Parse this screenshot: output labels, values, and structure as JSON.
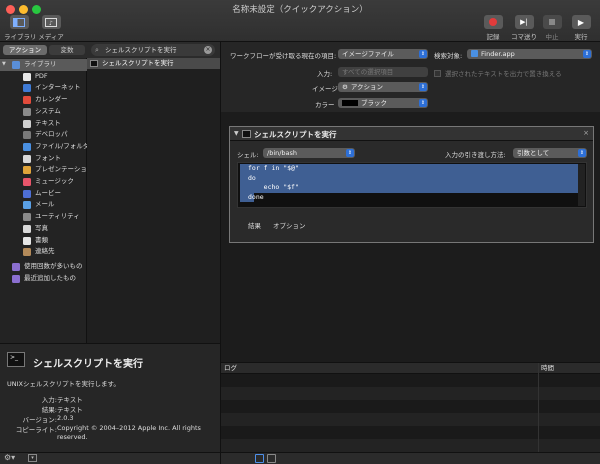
{
  "window": {
    "title": "名称未設定（クイックアクション）"
  },
  "toolbar": {
    "library": "ライブラリ",
    "media": "メディア",
    "record": "記録",
    "step": "コマ送り",
    "stop": "中止",
    "run": "実行"
  },
  "sidebar": {
    "tab_actions": "アクション",
    "tab_variables": "変数",
    "search_value": "シェルスクリプトを実行",
    "categories": [
      {
        "label": "ライブラリ",
        "icon": "library-icon",
        "color": "#5a8fd8"
      },
      {
        "label": "PDF",
        "icon": "pdf-icon",
        "color": "#e8e8e8"
      },
      {
        "label": "インターネット",
        "icon": "internet-icon",
        "color": "#3f7bd6"
      },
      {
        "label": "カレンダー",
        "icon": "calendar-icon",
        "color": "#e24b3b"
      },
      {
        "label": "システム",
        "icon": "system-icon",
        "color": "#8a8a8a"
      },
      {
        "label": "テキスト",
        "icon": "text-icon",
        "color": "#cfcfcf"
      },
      {
        "label": "デベロッパ",
        "icon": "developer-icon",
        "color": "#7a7a7a"
      },
      {
        "label": "ファイル/フォルダ",
        "icon": "folder-icon",
        "color": "#4a90e2"
      },
      {
        "label": "フォント",
        "icon": "font-icon",
        "color": "#d8d8d8"
      },
      {
        "label": "プレゼンテーション",
        "icon": "presentation-icon",
        "color": "#e0a43a"
      },
      {
        "label": "ミュージック",
        "icon": "music-icon",
        "color": "#e8556a"
      },
      {
        "label": "ムービー",
        "icon": "movie-icon",
        "color": "#4e6fd6"
      },
      {
        "label": "メール",
        "icon": "mail-icon",
        "color": "#5aa0e6"
      },
      {
        "label": "ユーティリティ",
        "icon": "utility-icon",
        "color": "#8a8a8a"
      },
      {
        "label": "写真",
        "icon": "photo-icon",
        "color": "#d9d9d9"
      },
      {
        "label": "書類",
        "icon": "document-icon",
        "color": "#e6e6e6"
      },
      {
        "label": "連絡先",
        "icon": "contacts-icon",
        "color": "#b38a5a"
      },
      {
        "label": "使用回数が多いもの",
        "icon": "smart-folder-icon",
        "color": "#8b6fd0"
      },
      {
        "label": "最近追加したもの",
        "icon": "smart-folder-icon",
        "color": "#8b6fd0"
      }
    ],
    "result_item": "シェルスクリプトを実行"
  },
  "description": {
    "title": "シェルスクリプトを実行",
    "summary": "UNIXシェルスクリプトを実行します。",
    "input_label": "入力:",
    "input_value": "テキスト",
    "result_label": "結果:",
    "result_value": "テキスト",
    "version_label": "バージョン:",
    "version_value": "2.0.3",
    "copyright_label": "コピーライト:",
    "copyright_value": "Copyright © 2004–2012 Apple Inc.  All rights reserved."
  },
  "workflow": {
    "receives_label": "ワークフローが受け取る現在の項目:",
    "receives_value": "イメージファイル",
    "search_target_label": "検索対象:",
    "search_target_value": "Finder.app",
    "input_label": "入力:",
    "input_value": "すべての選択項目",
    "replace_text_label": "選択されたテキストを出力で置き換える",
    "image_label": "イメージ",
    "image_value": "アクション",
    "color_label": "カラー",
    "color_value": "ブラック"
  },
  "action": {
    "title": "シェルスクリプトを実行",
    "shell_label": "シェル:",
    "shell_value": "/bin/bash",
    "pass_input_label": "入力の引き渡し方法:",
    "pass_input_value": "引数として",
    "code_lines": [
      "for f in \"$@\"",
      "do",
      "    echo \"$f\"",
      "done"
    ],
    "tab_results": "結果",
    "tab_options": "オプション"
  },
  "log": {
    "col_log": "ログ",
    "col_time": "時間"
  }
}
